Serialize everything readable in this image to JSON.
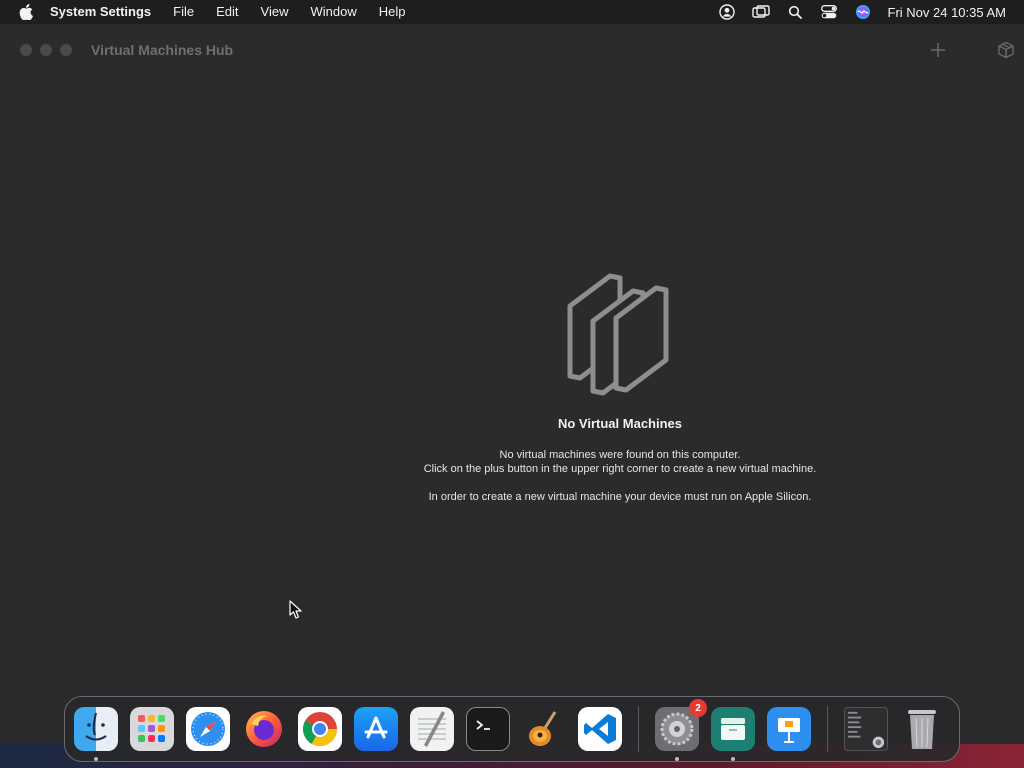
{
  "menubar": {
    "app_name": "System Settings",
    "menus": [
      "File",
      "Edit",
      "View",
      "Window",
      "Help"
    ],
    "clock": "Fri Nov 24  10:35 AM"
  },
  "window": {
    "title": "Virtual Machines Hub"
  },
  "empty_state": {
    "title": "No Virtual Machines",
    "line1": "No virtual machines were found on this computer.",
    "line2": "Click on the plus button in the upper right corner to create a new virtual machine.",
    "line3": "In order to create a new virtual machine your device must run on Apple Silicon."
  },
  "dock": {
    "items": [
      {
        "name": "Finder",
        "icon": "finder-icon",
        "running": true
      },
      {
        "name": "Launchpad",
        "icon": "launchpad-icon",
        "running": false
      },
      {
        "name": "Safari",
        "icon": "safari-icon",
        "running": false
      },
      {
        "name": "Firefox",
        "icon": "firefox-icon",
        "running": false
      },
      {
        "name": "Google Chrome",
        "icon": "chrome-icon",
        "running": false
      },
      {
        "name": "App Store",
        "icon": "app-store-icon",
        "running": false
      },
      {
        "name": "TextEdit",
        "icon": "textedit-icon",
        "running": false
      },
      {
        "name": "Terminal",
        "icon": "terminal-icon",
        "running": false
      },
      {
        "name": "GarageBand",
        "icon": "garageband-icon",
        "running": false
      },
      {
        "name": "Visual Studio Code",
        "icon": "vscode-icon",
        "running": false
      },
      {
        "name": "System Settings",
        "icon": "system-settings-icon",
        "running": true,
        "badge": "2"
      },
      {
        "name": "Virtual Machines Hub",
        "icon": "vm-hub-icon",
        "running": true
      },
      {
        "name": "Keynote",
        "icon": "keynote-icon",
        "running": false
      },
      {
        "name": "Recent Document",
        "icon": "document-thumbnail-icon",
        "running": false
      },
      {
        "name": "Trash",
        "icon": "trash-icon",
        "running": false
      }
    ],
    "badge_settings": "2"
  },
  "colors": {
    "window_bg": "#2b2b2d",
    "menubar_bg": "#1e1e1e",
    "badge": "#e53b30"
  }
}
